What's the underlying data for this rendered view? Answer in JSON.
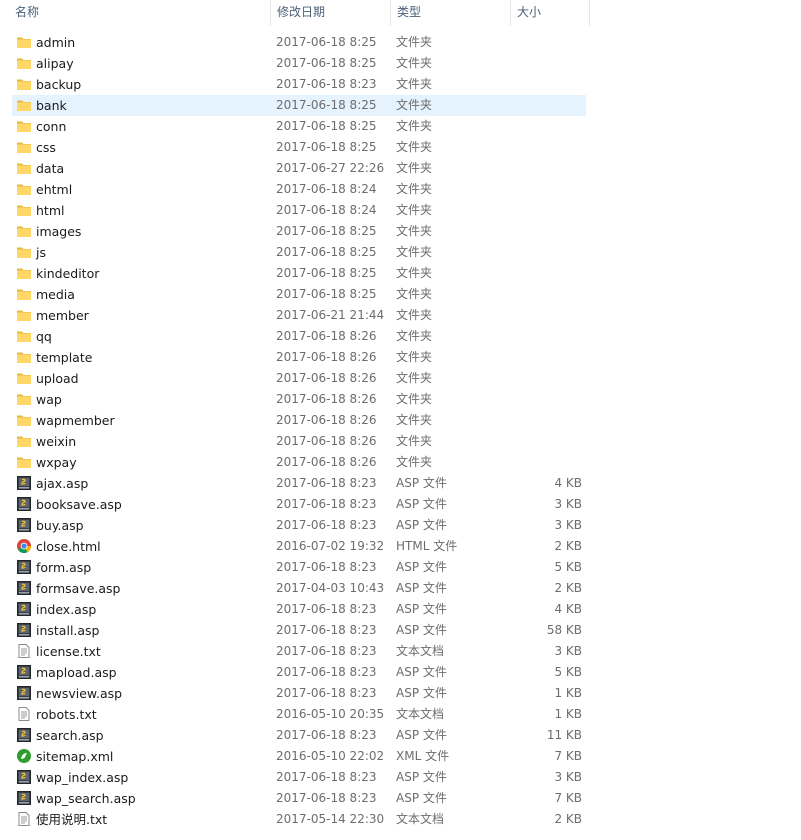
{
  "columns": {
    "name": "名称",
    "date": "修改日期",
    "type": "类型",
    "size": "大小"
  },
  "sort_indicator": "^",
  "colors": {
    "folder": "#ffd767",
    "folder_dark": "#e8b83a",
    "selected_row": "#e5f3ff",
    "header_text": "#4c607a"
  },
  "files": [
    {
      "name": "admin",
      "date": "2017-06-18 8:25",
      "type": "文件夹",
      "size": "",
      "icon": "folder-icon"
    },
    {
      "name": "alipay",
      "date": "2017-06-18 8:25",
      "type": "文件夹",
      "size": "",
      "icon": "folder-icon"
    },
    {
      "name": "backup",
      "date": "2017-06-18 8:23",
      "type": "文件夹",
      "size": "",
      "icon": "folder-icon"
    },
    {
      "name": "bank",
      "date": "2017-06-18 8:25",
      "type": "文件夹",
      "size": "",
      "icon": "folder-icon",
      "selected": true
    },
    {
      "name": "conn",
      "date": "2017-06-18 8:25",
      "type": "文件夹",
      "size": "",
      "icon": "folder-icon"
    },
    {
      "name": "css",
      "date": "2017-06-18 8:25",
      "type": "文件夹",
      "size": "",
      "icon": "folder-icon"
    },
    {
      "name": "data",
      "date": "2017-06-27 22:26",
      "type": "文件夹",
      "size": "",
      "icon": "folder-icon"
    },
    {
      "name": "ehtml",
      "date": "2017-06-18 8:24",
      "type": "文件夹",
      "size": "",
      "icon": "folder-icon"
    },
    {
      "name": "html",
      "date": "2017-06-18 8:24",
      "type": "文件夹",
      "size": "",
      "icon": "folder-icon"
    },
    {
      "name": "images",
      "date": "2017-06-18 8:25",
      "type": "文件夹",
      "size": "",
      "icon": "folder-icon"
    },
    {
      "name": "js",
      "date": "2017-06-18 8:25",
      "type": "文件夹",
      "size": "",
      "icon": "folder-icon"
    },
    {
      "name": "kindeditor",
      "date": "2017-06-18 8:25",
      "type": "文件夹",
      "size": "",
      "icon": "folder-icon"
    },
    {
      "name": "media",
      "date": "2017-06-18 8:25",
      "type": "文件夹",
      "size": "",
      "icon": "folder-icon"
    },
    {
      "name": "member",
      "date": "2017-06-21 21:44",
      "type": "文件夹",
      "size": "",
      "icon": "folder-icon"
    },
    {
      "name": "qq",
      "date": "2017-06-18 8:26",
      "type": "文件夹",
      "size": "",
      "icon": "folder-icon"
    },
    {
      "name": "template",
      "date": "2017-06-18 8:26",
      "type": "文件夹",
      "size": "",
      "icon": "folder-icon"
    },
    {
      "name": "upload",
      "date": "2017-06-18 8:26",
      "type": "文件夹",
      "size": "",
      "icon": "folder-icon"
    },
    {
      "name": "wap",
      "date": "2017-06-18 8:26",
      "type": "文件夹",
      "size": "",
      "icon": "folder-icon"
    },
    {
      "name": "wapmember",
      "date": "2017-06-18 8:26",
      "type": "文件夹",
      "size": "",
      "icon": "folder-icon"
    },
    {
      "name": "weixin",
      "date": "2017-06-18 8:26",
      "type": "文件夹",
      "size": "",
      "icon": "folder-icon"
    },
    {
      "name": "wxpay",
      "date": "2017-06-18 8:26",
      "type": "文件夹",
      "size": "",
      "icon": "folder-icon"
    },
    {
      "name": "ajax.asp",
      "date": "2017-06-18 8:23",
      "type": "ASP 文件",
      "size": "4 KB",
      "icon": "asp-file-icon"
    },
    {
      "name": "booksave.asp",
      "date": "2017-06-18 8:23",
      "type": "ASP 文件",
      "size": "3 KB",
      "icon": "asp-file-icon"
    },
    {
      "name": "buy.asp",
      "date": "2017-06-18 8:23",
      "type": "ASP 文件",
      "size": "3 KB",
      "icon": "asp-file-icon"
    },
    {
      "name": "close.html",
      "date": "2016-07-02 19:32",
      "type": "HTML 文件",
      "size": "2 KB",
      "icon": "chrome-html-icon"
    },
    {
      "name": "form.asp",
      "date": "2017-06-18 8:23",
      "type": "ASP 文件",
      "size": "5 KB",
      "icon": "asp-file-icon"
    },
    {
      "name": "formsave.asp",
      "date": "2017-04-03 10:43",
      "type": "ASP 文件",
      "size": "2 KB",
      "icon": "asp-file-icon"
    },
    {
      "name": "index.asp",
      "date": "2017-06-18 8:23",
      "type": "ASP 文件",
      "size": "4 KB",
      "icon": "asp-file-icon"
    },
    {
      "name": "install.asp",
      "date": "2017-06-18 8:23",
      "type": "ASP 文件",
      "size": "58 KB",
      "icon": "asp-file-icon"
    },
    {
      "name": "license.txt",
      "date": "2017-06-18 8:23",
      "type": "文本文档",
      "size": "3 KB",
      "icon": "text-file-icon"
    },
    {
      "name": "mapload.asp",
      "date": "2017-06-18 8:23",
      "type": "ASP 文件",
      "size": "5 KB",
      "icon": "asp-file-icon"
    },
    {
      "name": "newsview.asp",
      "date": "2017-06-18 8:23",
      "type": "ASP 文件",
      "size": "1 KB",
      "icon": "asp-file-icon"
    },
    {
      "name": "robots.txt",
      "date": "2016-05-10 20:35",
      "type": "文本文档",
      "size": "1 KB",
      "icon": "text-file-icon"
    },
    {
      "name": "search.asp",
      "date": "2017-06-18 8:23",
      "type": "ASP 文件",
      "size": "11 KB",
      "icon": "asp-file-icon"
    },
    {
      "name": "sitemap.xml",
      "date": "2016-05-10 22:02",
      "type": "XML 文件",
      "size": "7 KB",
      "icon": "xml-file-icon"
    },
    {
      "name": "wap_index.asp",
      "date": "2017-06-18 8:23",
      "type": "ASP 文件",
      "size": "3 KB",
      "icon": "asp-file-icon"
    },
    {
      "name": "wap_search.asp",
      "date": "2017-06-18 8:23",
      "type": "ASP 文件",
      "size": "7 KB",
      "icon": "asp-file-icon"
    },
    {
      "name": "使用说明.txt",
      "date": "2017-05-14 22:30",
      "type": "文本文档",
      "size": "2 KB",
      "icon": "text-file-icon"
    }
  ]
}
